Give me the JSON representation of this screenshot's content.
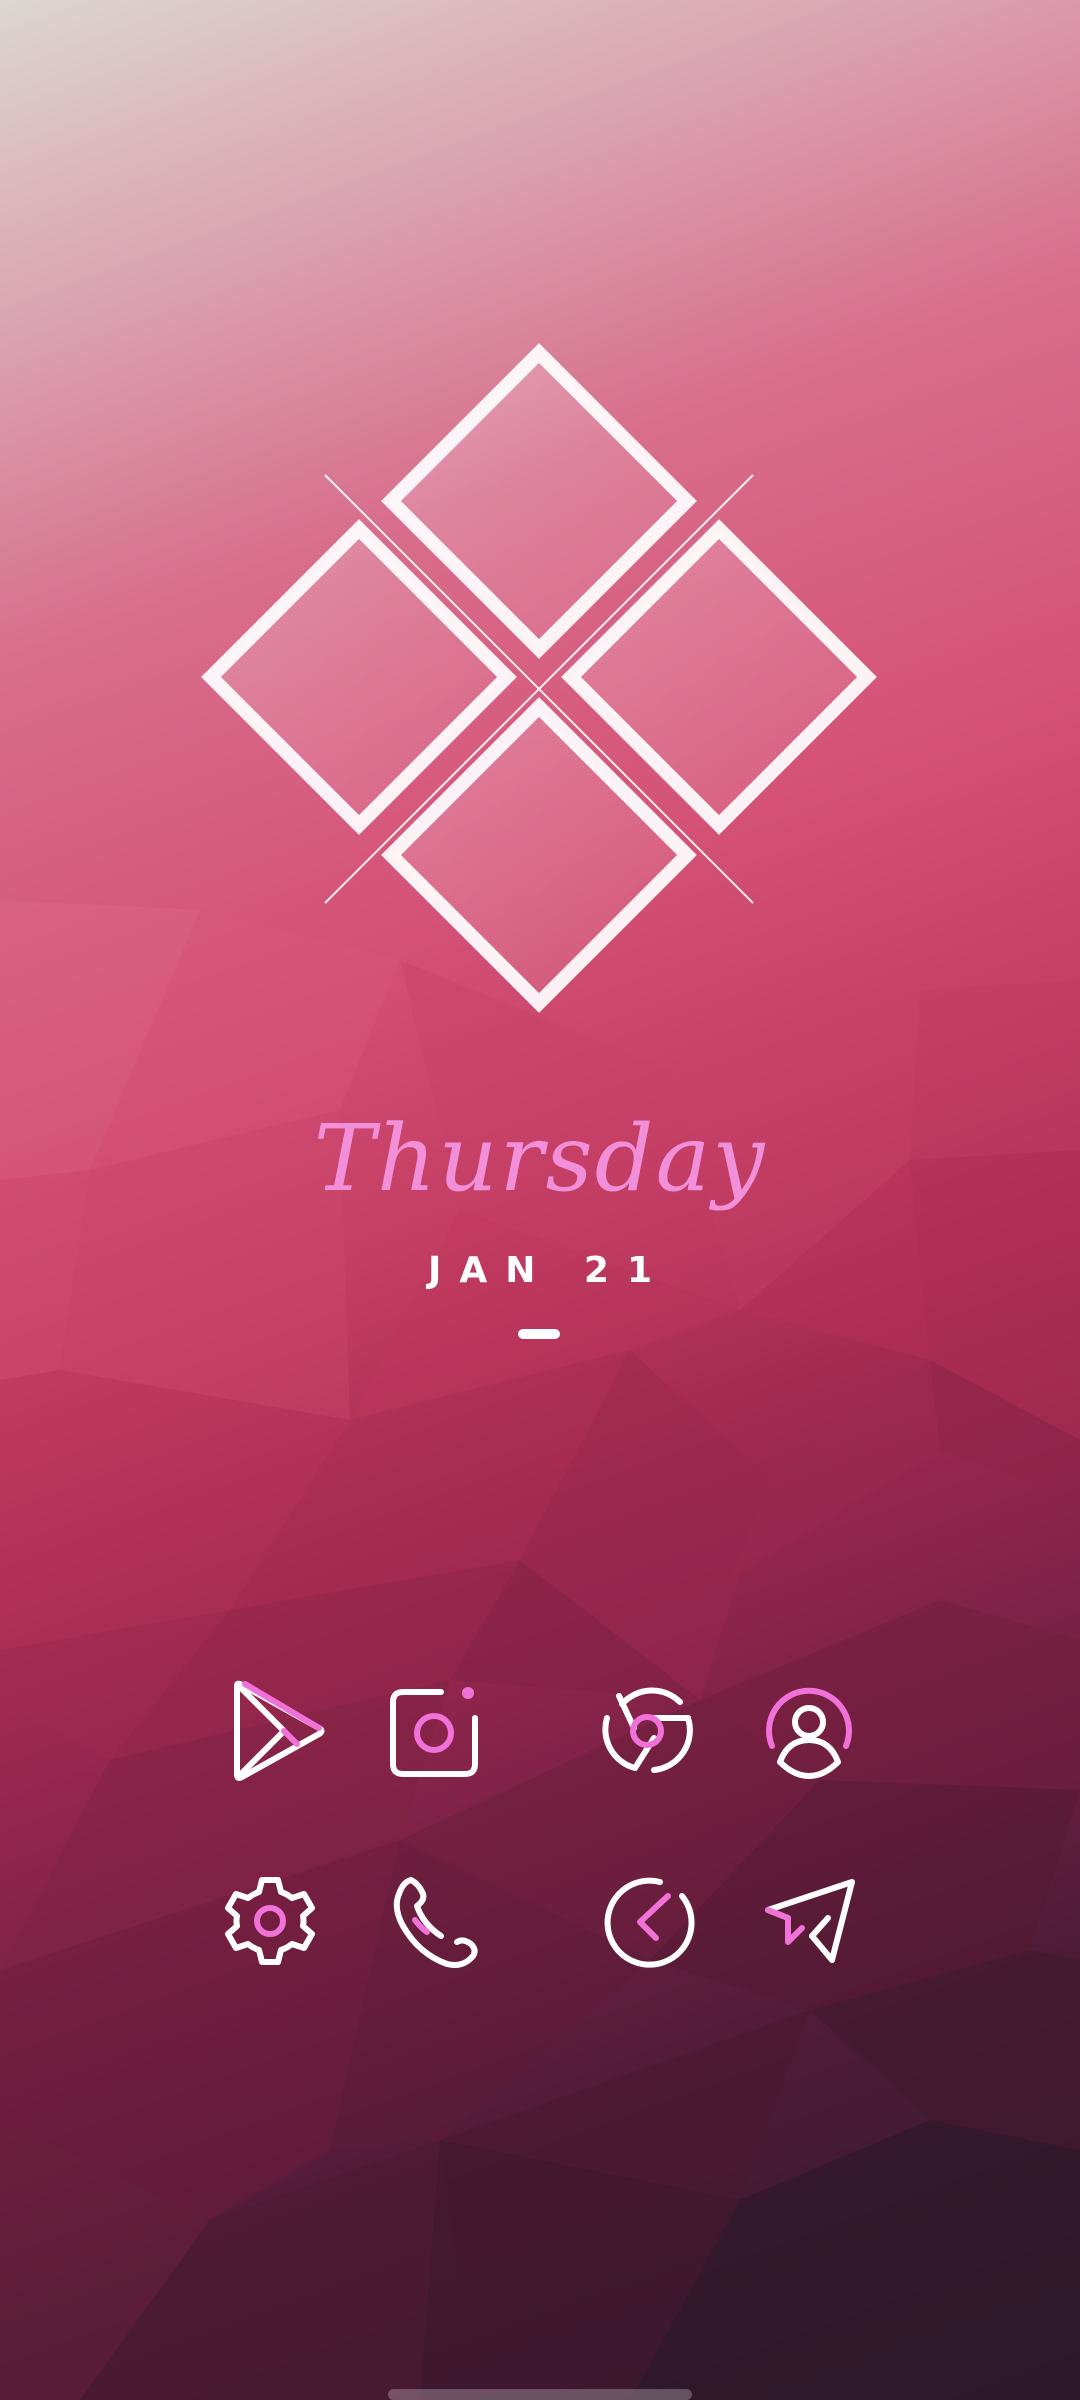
{
  "colors": {
    "accent_pink": "#f072d8",
    "icon_white": "#ffffff",
    "script_pink": "#f28fd9"
  },
  "widget": {
    "day_name": "Thursday",
    "date": "JAN 21"
  },
  "dock": {
    "row1": [
      {
        "icon": "play-store-icon"
      },
      {
        "icon": "camera-icon"
      },
      {
        "icon": "chrome-icon"
      },
      {
        "icon": "contacts-icon"
      }
    ],
    "row2": [
      {
        "icon": "settings-icon"
      },
      {
        "icon": "phone-icon"
      },
      {
        "icon": "clock-icon"
      },
      {
        "icon": "send-icon"
      }
    ]
  }
}
